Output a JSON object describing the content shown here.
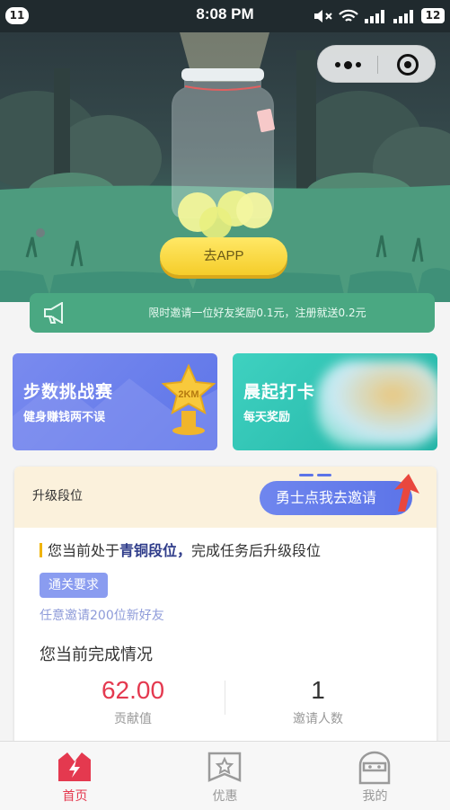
{
  "status_bar": {
    "badge": "11",
    "time": "8:08 PM",
    "battery": "12"
  },
  "hero": {
    "button_label": "去APP"
  },
  "notice": {
    "text": "限时邀请一位好友奖励0.1元，注册就送0.2元"
  },
  "cards": [
    {
      "title": "步数挑战赛",
      "subtitle": "健身赚钱两不误",
      "badge": "2KM"
    },
    {
      "title": "晨起打卡",
      "subtitle": "每天奖励"
    }
  ],
  "panel": {
    "title": "升级段位",
    "invite_label": "勇士点我去邀请",
    "level_prefix": "您当前处于",
    "level_name": "青铜段位，",
    "level_suffix": "完成任务后升级段位",
    "requirement_tag": "通关要求",
    "requirement_text": "任意邀请200位新好友",
    "progress_title": "您当前完成情况",
    "stats": [
      {
        "value": "62.00",
        "label": "贡献值"
      },
      {
        "value": "1",
        "label": "邀请人数"
      }
    ]
  },
  "tabs": [
    {
      "label": "首页",
      "active": true,
      "icon": "home-crown-icon"
    },
    {
      "label": "优惠",
      "active": false,
      "icon": "coupon-star-icon"
    },
    {
      "label": "我的",
      "active": false,
      "icon": "profile-icon"
    }
  ],
  "colors": {
    "accent_red": "#e4394f",
    "notice_green": "#4aa882",
    "card_blue": "#6f86ee",
    "card_teal": "#2cc2b2"
  }
}
